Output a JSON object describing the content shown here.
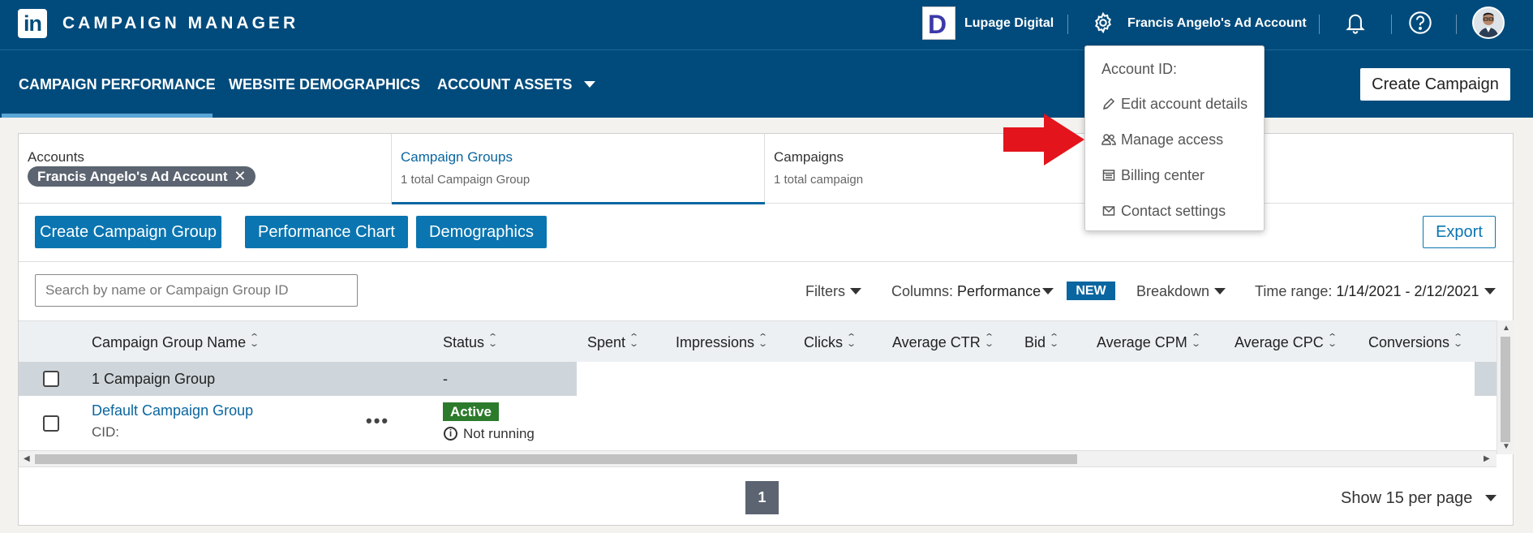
{
  "header": {
    "logo_text": "in",
    "app_title": "CAMPAIGN MANAGER",
    "brand_logo_letter": "D",
    "brand_name": "Lupage Digital",
    "account_name": "Francis Angelo's Ad Account"
  },
  "nav": {
    "tabs": [
      {
        "label": "CAMPAIGN PERFORMANCE"
      },
      {
        "label": "WEBSITE DEMOGRAPHICS"
      },
      {
        "label": "ACCOUNT ASSETS"
      }
    ],
    "create_campaign_label": "Create Campaign"
  },
  "dropdown": {
    "account_id_label": "Account ID:",
    "items": [
      {
        "label": "Edit account details",
        "icon": "pencil-icon"
      },
      {
        "label": "Manage access",
        "icon": "users-icon"
      },
      {
        "label": "Billing center",
        "icon": "billing-icon"
      },
      {
        "label": "Contact settings",
        "icon": "envelope-icon"
      }
    ]
  },
  "level_tabs": {
    "accounts": {
      "title": "Accounts",
      "pill": "Francis Angelo's Ad Account"
    },
    "campaign_groups": {
      "title": "Campaign Groups",
      "sub": "1 total Campaign Group"
    },
    "campaigns": {
      "title": "Campaigns",
      "sub": "1 total campaign"
    }
  },
  "actions": {
    "create_group": "Create Campaign Group",
    "performance_chart": "Performance Chart",
    "demographics": "Demographics",
    "export": "Export"
  },
  "filters": {
    "search_placeholder": "Search by name or Campaign Group ID",
    "filters_label": "Filters",
    "columns_label": "Columns:",
    "columns_value": "Performance",
    "new_badge": "NEW",
    "breakdown_label": "Breakdown",
    "time_range_label": "Time range:",
    "time_range_value": "1/14/2021 - 2/12/2021"
  },
  "table": {
    "columns": [
      "Campaign Group Name",
      "Status",
      "Spent",
      "Impressions",
      "Clicks",
      "Average CTR",
      "Bid",
      "Average CPM",
      "Average CPC",
      "Conversions"
    ],
    "summary": {
      "name": "1 Campaign Group",
      "status": "-"
    },
    "rows": [
      {
        "name": "Default Campaign Group",
        "cid": "CID:",
        "status": "Active",
        "run_state": "Not running"
      }
    ]
  },
  "pagination": {
    "current_page": "1",
    "per_page": "Show 15 per page"
  },
  "colors": {
    "header_bg": "#004b7c",
    "primary_button": "#0a75b0",
    "link": "#0a66a0",
    "active_badge": "#2c7a2c",
    "annotation_arrow": "#e3141c"
  }
}
